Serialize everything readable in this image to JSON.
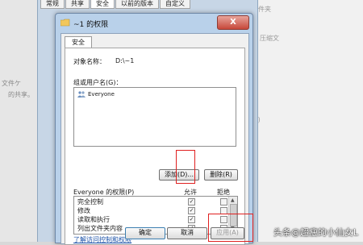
{
  "background": {
    "tabs": [
      "常规",
      "共享",
      "安全",
      "以前的版本",
      "自定义"
    ],
    "right_texts": [
      "文件夹",
      "压缩文",
      "(P",
      "...",
      "(L)"
    ],
    "left_texts": [
      "文件ケ",
      "的共享。"
    ]
  },
  "dialog": {
    "title": "~1 的权限",
    "close": "X",
    "tab": "安全",
    "object_label": "对象名称：",
    "object_value": "D:\\~1",
    "group_label": "组或用户名(G)：",
    "users": [
      "Everyone"
    ],
    "add_button": "添加(D)...",
    "remove_button": "删除(R)",
    "perm_title": "Everyone 的权限(P)",
    "allow_header": "允许",
    "deny_header": "拒绝",
    "permissions": [
      {
        "name": "完全控制",
        "allow": true,
        "deny": false
      },
      {
        "name": "修改",
        "allow": true,
        "deny": false
      },
      {
        "name": "读取和执行",
        "allow": true,
        "deny": false
      },
      {
        "name": "列出文件夹内容",
        "allow": true,
        "deny": false
      },
      {
        "name": "读取",
        "allow": true,
        "deny": false
      }
    ],
    "advanced_link": "了解访问控制和权限",
    "ok_button": "确定",
    "cancel_button": "取消",
    "apply_button": "应用(A)"
  },
  "watermark": "头条@超瘦的小仙女L",
  "colors": {
    "highlight": "#e02020",
    "link": "#1c52a8",
    "titlebar": "#b9d1ea"
  }
}
